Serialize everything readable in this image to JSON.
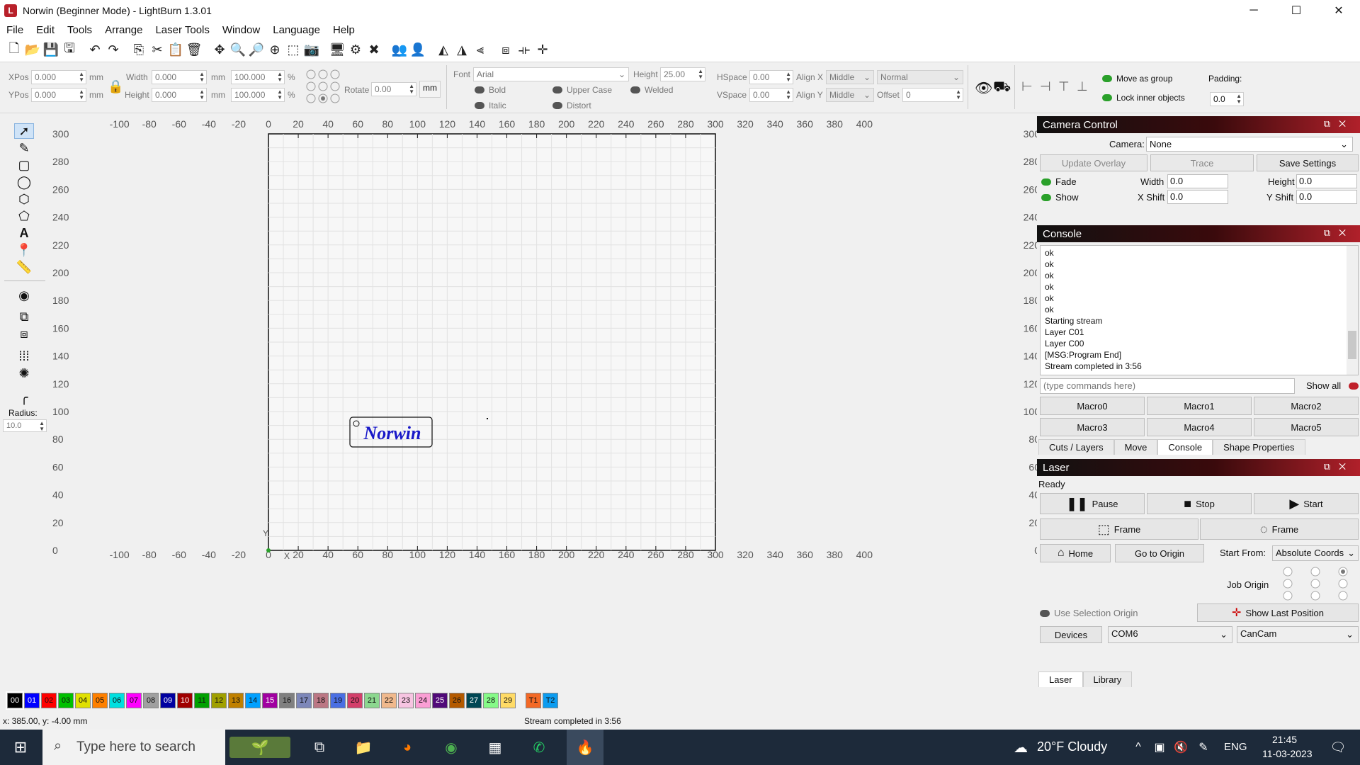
{
  "window": {
    "title": "Norwin (Beginner Mode) - LightBurn 1.3.01",
    "min": "─",
    "max": "☐",
    "close": "✕"
  },
  "menu": [
    "File",
    "Edit",
    "Tools",
    "Arrange",
    "Laser Tools",
    "Window",
    "Language",
    "Help"
  ],
  "props": {
    "xpos_label": "XPos",
    "xpos": "0.000",
    "ypos_label": "YPos",
    "ypos": "0.000",
    "width_label": "Width",
    "width": "0.000",
    "height_label": "Height",
    "height": "0.000",
    "unit": "mm",
    "pct_w": "100.000",
    "pct_h": "100.000",
    "pct": "%",
    "rotate_label": "Rotate",
    "rotate": "0.00",
    "mm_btn": "mm",
    "font_label": "Font",
    "font": "Arial",
    "fheight_label": "Height",
    "fheight": "25.00",
    "hspace_label": "HSpace",
    "hspace": "0.00",
    "vspace_label": "VSpace",
    "vspace": "0.00",
    "alignx_label": "Align X",
    "alignx": "Middle",
    "aligny_label": "Align Y",
    "aligny": "Middle",
    "normal": "Normal",
    "offset_label": "Offset",
    "offset": "0",
    "bold": "Bold",
    "italic": "Italic",
    "upper": "Upper Case",
    "distort": "Distort",
    "welded": "Welded",
    "move_group": "Move as group",
    "lock_inner": "Lock inner objects",
    "padding_label": "Padding:",
    "padding": "0.0"
  },
  "lefttools": {
    "radius_label": "Radius:",
    "radius": "10.0"
  },
  "axes": {
    "top_x": [
      "-100",
      "-80",
      "-60",
      "-40",
      "-20",
      "0",
      "20",
      "40",
      "60",
      "80",
      "100",
      "120",
      "140",
      "160",
      "180",
      "200",
      "220",
      "240",
      "260",
      "280",
      "300",
      "320",
      "340",
      "360",
      "380",
      "400"
    ],
    "left_y": [
      "300",
      "280",
      "260",
      "240",
      "220",
      "200",
      "180",
      "160",
      "140",
      "120",
      "100",
      "80",
      "60",
      "40",
      "20",
      "0"
    ],
    "x_axis_label": "X",
    "y_axis_label": "Y"
  },
  "design_text": "Norwin",
  "camera": {
    "title": "Camera Control",
    "camera_label": "Camera:",
    "camera": "None",
    "update_overlay": "Update Overlay",
    "trace": "Trace",
    "save_settings": "Save Settings",
    "fade": "Fade",
    "show": "Show",
    "width_label": "Width",
    "width": "0.0",
    "height_label": "Height",
    "height": "0.0",
    "xshift_label": "X Shift",
    "xshift": "0.0",
    "yshift_label": "Y Shift",
    "yshift": "0.0"
  },
  "console": {
    "title": "Console",
    "lines": [
      "ok",
      "ok",
      "ok",
      "ok",
      "ok",
      "ok",
      "Starting stream",
      "Layer C01",
      "Layer C00",
      "[MSG:Program End]",
      "Stream completed in 3:56"
    ],
    "placeholder": "(type commands here)",
    "show_all": "Show all",
    "macros": [
      "Macro0",
      "Macro1",
      "Macro2",
      "Macro3",
      "Macro4",
      "Macro5"
    ],
    "tabs": [
      "Cuts / Layers",
      "Move",
      "Console",
      "Shape Properties"
    ]
  },
  "laser": {
    "title": "Laser",
    "status": "Ready",
    "pause": "Pause",
    "stop": "Stop",
    "start": "Start",
    "frame1": "Frame",
    "frame2": "Frame",
    "home": "Home",
    "goto_origin": "Go to Origin",
    "start_from_label": "Start From:",
    "start_from": "Absolute Coords",
    "job_origin": "Job Origin",
    "use_sel_origin": "Use Selection Origin",
    "show_last": "Show Last Position",
    "devices": "Devices",
    "port": "COM6",
    "device": "CanCam",
    "tabs": [
      "Laser",
      "Library"
    ]
  },
  "palette": [
    {
      "id": "00",
      "color": "#000000"
    },
    {
      "id": "01",
      "color": "#0000ff"
    },
    {
      "id": "02",
      "color": "#ff0000"
    },
    {
      "id": "03",
      "color": "#00c000"
    },
    {
      "id": "04",
      "color": "#e0e000"
    },
    {
      "id": "05",
      "color": "#ff8000"
    },
    {
      "id": "06",
      "color": "#00e0e0"
    },
    {
      "id": "07",
      "color": "#ff00ff"
    },
    {
      "id": "08",
      "color": "#a0a0a0"
    },
    {
      "id": "09",
      "color": "#0000a0"
    },
    {
      "id": "10",
      "color": "#a00000"
    },
    {
      "id": "11",
      "color": "#00a000"
    },
    {
      "id": "12",
      "color": "#a0a000"
    },
    {
      "id": "13",
      "color": "#c08000"
    },
    {
      "id": "14",
      "color": "#00a0ff"
    },
    {
      "id": "15",
      "color": "#a000a0"
    },
    {
      "id": "16",
      "color": "#808080"
    },
    {
      "id": "17",
      "color": "#7d87b9"
    },
    {
      "id": "18",
      "color": "#bb7784"
    },
    {
      "id": "19",
      "color": "#4a6fe3"
    },
    {
      "id": "20",
      "color": "#d33f6a"
    },
    {
      "id": "21",
      "color": "#8cd78f"
    },
    {
      "id": "22",
      "color": "#f0b98d"
    },
    {
      "id": "23",
      "color": "#f6c4e1"
    },
    {
      "id": "24",
      "color": "#fa9ed4"
    },
    {
      "id": "25",
      "color": "#500a78"
    },
    {
      "id": "26",
      "color": "#b45a00"
    },
    {
      "id": "27",
      "color": "#004754"
    },
    {
      "id": "28",
      "color": "#86fa88"
    },
    {
      "id": "29",
      "color": "#ffdb66"
    },
    {
      "id": "T1",
      "color": "#f36926"
    },
    {
      "id": "T2",
      "color": "#0c9cf0"
    }
  ],
  "status": {
    "coords": "x: 385.00, y: -4.00 mm",
    "message": "Stream completed in 3:56"
  },
  "taskbar": {
    "search": "Type here to search",
    "weather": "20°F  Cloudy",
    "lang": "ENG",
    "time": "21:45",
    "date": "11-03-2023"
  }
}
